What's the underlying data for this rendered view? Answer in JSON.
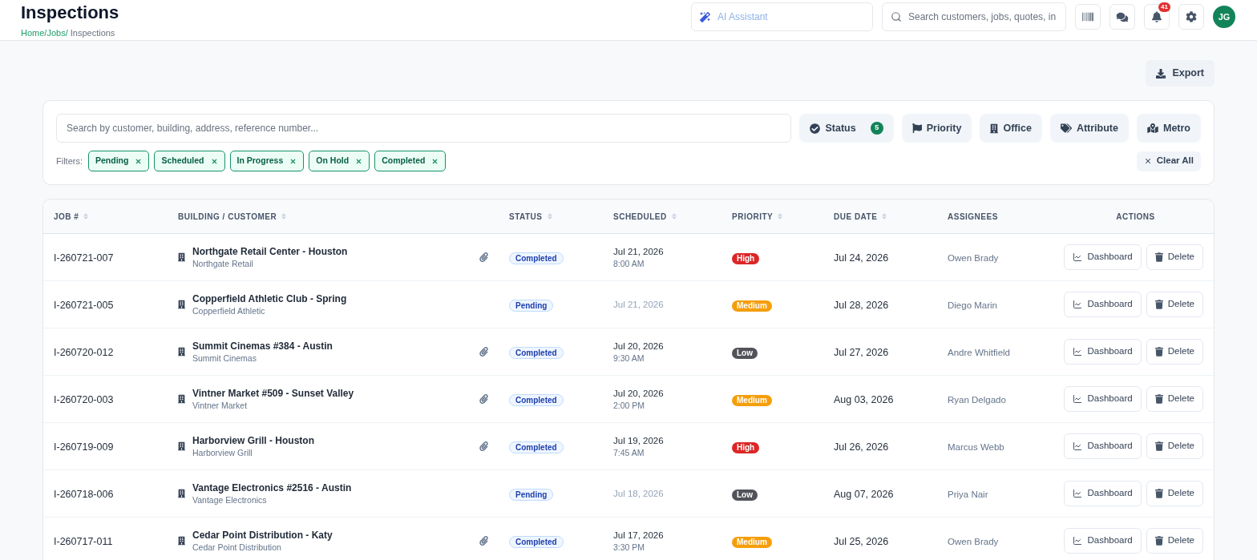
{
  "header": {
    "title": "Inspections",
    "breadcrumb": [
      {
        "label": "Home",
        "current": false
      },
      {
        "label": "Jobs",
        "current": false
      },
      {
        "label": "Inspections",
        "current": true
      }
    ],
    "breadcrumb_separator": "/"
  },
  "top_bar": {
    "ai_assistant": {
      "placeholder": "AI Assistant"
    },
    "search": {
      "placeholder": "Search customers, jobs, quotes, in"
    },
    "notification_count": "41",
    "avatar_initials": "JG"
  },
  "toolbar": {
    "export_button": "Export"
  },
  "filter_panel": {
    "search": {
      "placeholder": "Search by customer, building, address, reference number..."
    },
    "filter_buttons": [
      {
        "label": "Status",
        "kind": "status",
        "count": "5"
      },
      {
        "label": "Priority",
        "kind": "priority"
      },
      {
        "label": "Office",
        "kind": "office"
      },
      {
        "label": "Attribute",
        "kind": "attribute"
      },
      {
        "label": "Metro",
        "kind": "metro"
      }
    ],
    "filters_label": "Filters:",
    "active_filters": [
      "Pending",
      "Scheduled",
      "In Progress",
      "On Hold",
      "Completed"
    ],
    "clear_all": "Clear All"
  },
  "table": {
    "columns": [
      {
        "label": "JOB #",
        "sortable": true
      },
      {
        "label": "BUILDING / CUSTOMER",
        "sortable": true
      },
      {
        "label": "STATUS",
        "sortable": true
      },
      {
        "label": "SCHEDULED",
        "sortable": true
      },
      {
        "label": "PRIORITY",
        "sortable": true
      },
      {
        "label": "DUE DATE",
        "sortable": true
      },
      {
        "label": "ASSIGNEES",
        "sortable": false
      },
      {
        "label": "ACTIONS",
        "sortable": false
      }
    ],
    "rows": [
      {
        "job_number": "I-260721-007",
        "building": "Northgate Retail Center - Houston",
        "customer": "Northgate Retail",
        "has_attachment": true,
        "status": "Completed",
        "scheduled": {
          "date": "Jul 21, 2026",
          "time": "8:00 AM"
        },
        "priority": {
          "label": "High",
          "color": "#dc2626"
        },
        "due_date": "Jul 24, 2026",
        "assignee": "Owen Brady",
        "actions": [
          {
            "label": "Dashboard",
            "kind": "dashboard"
          },
          {
            "label": "Delete",
            "kind": "delete"
          }
        ]
      },
      {
        "job_number": "I-260721-005",
        "building": "Copperfield Athletic Club - Spring",
        "customer": "Copperfield Athletic",
        "has_attachment": false,
        "status": "Pending",
        "scheduled": {
          "date": "Jul 21, 2026"
        },
        "priority": {
          "label": "Medium",
          "color": "#f59e0b"
        },
        "due_date": "Jul 28, 2026",
        "assignee": "Diego Marin",
        "actions": [
          {
            "label": "Dashboard",
            "kind": "dashboard"
          },
          {
            "label": "Delete",
            "kind": "delete"
          }
        ]
      },
      {
        "job_number": "I-260720-012",
        "building": "Summit Cinemas #384 - Austin",
        "customer": "Summit Cinemas",
        "has_attachment": true,
        "status": "Completed",
        "scheduled": {
          "date": "Jul 20, 2026",
          "time": "9:30 AM"
        },
        "priority": {
          "label": "Low",
          "color": "#52525b"
        },
        "due_date": "Jul 27, 2026",
        "assignee": "Andre Whitfield",
        "actions": [
          {
            "label": "Dashboard",
            "kind": "dashboard"
          },
          {
            "label": "Delete",
            "kind": "delete"
          }
        ]
      },
      {
        "job_number": "I-260720-003",
        "building": "Vintner Market #509 - Sunset Valley",
        "customer": "Vintner Market",
        "has_attachment": true,
        "status": "Completed",
        "scheduled": {
          "date": "Jul 20, 2026",
          "time": "2:00 PM"
        },
        "priority": {
          "label": "Medium",
          "color": "#f59e0b"
        },
        "due_date": "Aug 03, 2026",
        "assignee": "Ryan Delgado",
        "actions": [
          {
            "label": "Dashboard",
            "kind": "dashboard"
          },
          {
            "label": "Delete",
            "kind": "delete"
          }
        ]
      },
      {
        "job_number": "I-260719-009",
        "building": "Harborview Grill - Houston",
        "customer": "Harborview Grill",
        "has_attachment": true,
        "status": "Completed",
        "scheduled": {
          "date": "Jul 19, 2026",
          "time": "7:45 AM"
        },
        "priority": {
          "label": "High",
          "color": "#dc2626"
        },
        "due_date": "Jul 26, 2026",
        "assignee": "Marcus Webb",
        "actions": [
          {
            "label": "Dashboard",
            "kind": "dashboard"
          },
          {
            "label": "Delete",
            "kind": "delete"
          }
        ]
      },
      {
        "job_number": "I-260718-006",
        "building": "Vantage Electronics #2516 - Austin",
        "customer": "Vantage Electronics",
        "has_attachment": false,
        "status": "Pending",
        "scheduled": {
          "date": "Jul 18, 2026"
        },
        "priority": {
          "label": "Low",
          "color": "#52525b"
        },
        "due_date": "Aug 07, 2026",
        "assignee": "Priya Nair",
        "actions": [
          {
            "label": "Dashboard",
            "kind": "dashboard"
          },
          {
            "label": "Delete",
            "kind": "delete"
          }
        ]
      },
      {
        "job_number": "I-260717-011",
        "building": "Cedar Point Distribution - Katy",
        "customer": "Cedar Point Distribution",
        "has_attachment": true,
        "status": "Completed",
        "scheduled": {
          "date": "Jul 17, 2026",
          "time": "3:30 PM"
        },
        "priority": {
          "label": "Medium",
          "color": "#f59e0b"
        },
        "due_date": "Jul 25, 2026",
        "assignee": "Owen Brady",
        "actions": [
          {
            "label": "Dashboard",
            "kind": "dashboard"
          },
          {
            "label": "Delete",
            "kind": "delete"
          }
        ]
      }
    ]
  }
}
